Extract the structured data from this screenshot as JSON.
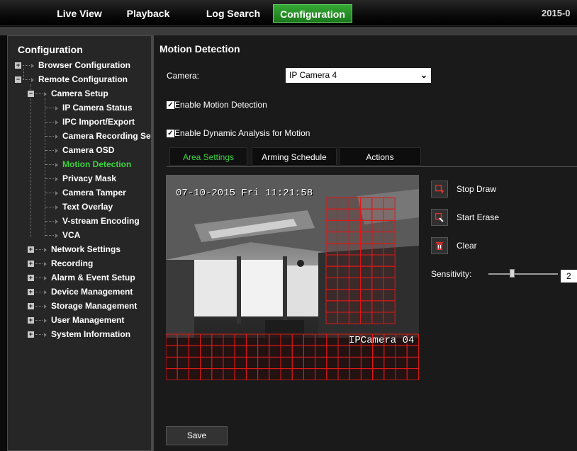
{
  "header": {
    "tabs": [
      {
        "label": "Live View"
      },
      {
        "label": "Playback"
      },
      {
        "label": "Log Search"
      },
      {
        "label": "Configuration"
      }
    ],
    "date": "2015-0"
  },
  "sidebar": {
    "title": "Configuration",
    "items": [
      {
        "label": "Browser Configuration"
      },
      {
        "label": "Remote Configuration"
      },
      {
        "label": "Camera Setup"
      },
      {
        "label": "IP Camera Status"
      },
      {
        "label": "IPC Import/Export"
      },
      {
        "label": "Camera Recording Set"
      },
      {
        "label": "Camera OSD"
      },
      {
        "label": "Motion Detection"
      },
      {
        "label": "Privacy Mask"
      },
      {
        "label": "Camera Tamper"
      },
      {
        "label": "Text Overlay"
      },
      {
        "label": "V-stream Encoding"
      },
      {
        "label": "VCA"
      },
      {
        "label": "Network Settings"
      },
      {
        "label": "Recording"
      },
      {
        "label": "Alarm & Event Setup"
      },
      {
        "label": "Device Management"
      },
      {
        "label": "Storage Management"
      },
      {
        "label": "User Management"
      },
      {
        "label": "System Information"
      }
    ]
  },
  "main": {
    "heading": "Motion Detection",
    "camera_label": "Camera:",
    "camera_value": "IP Camera 4",
    "enable_motion": "Enable Motion Detection",
    "enable_dynamic": "Enable Dynamic Analysis for Motion",
    "tabs": [
      {
        "label": "Area Settings"
      },
      {
        "label": "Arming Schedule"
      },
      {
        "label": "Actions"
      }
    ],
    "video": {
      "timestamp": "07-10-2015 Fri 11:21:58",
      "camera_name": "IPCamera 04"
    },
    "controls": {
      "stop_draw": "Stop Draw",
      "start_erase": "Start Erase",
      "clear": "Clear"
    },
    "sensitivity_label": "Sensitivity:",
    "sensitivity_value": "2",
    "sensitivity_level": 2,
    "save_label": "Save"
  },
  "colors": {
    "accent_green": "#3ed23e",
    "grid_red": "#e01818",
    "active_tab_bg": "#1b7a1b"
  }
}
